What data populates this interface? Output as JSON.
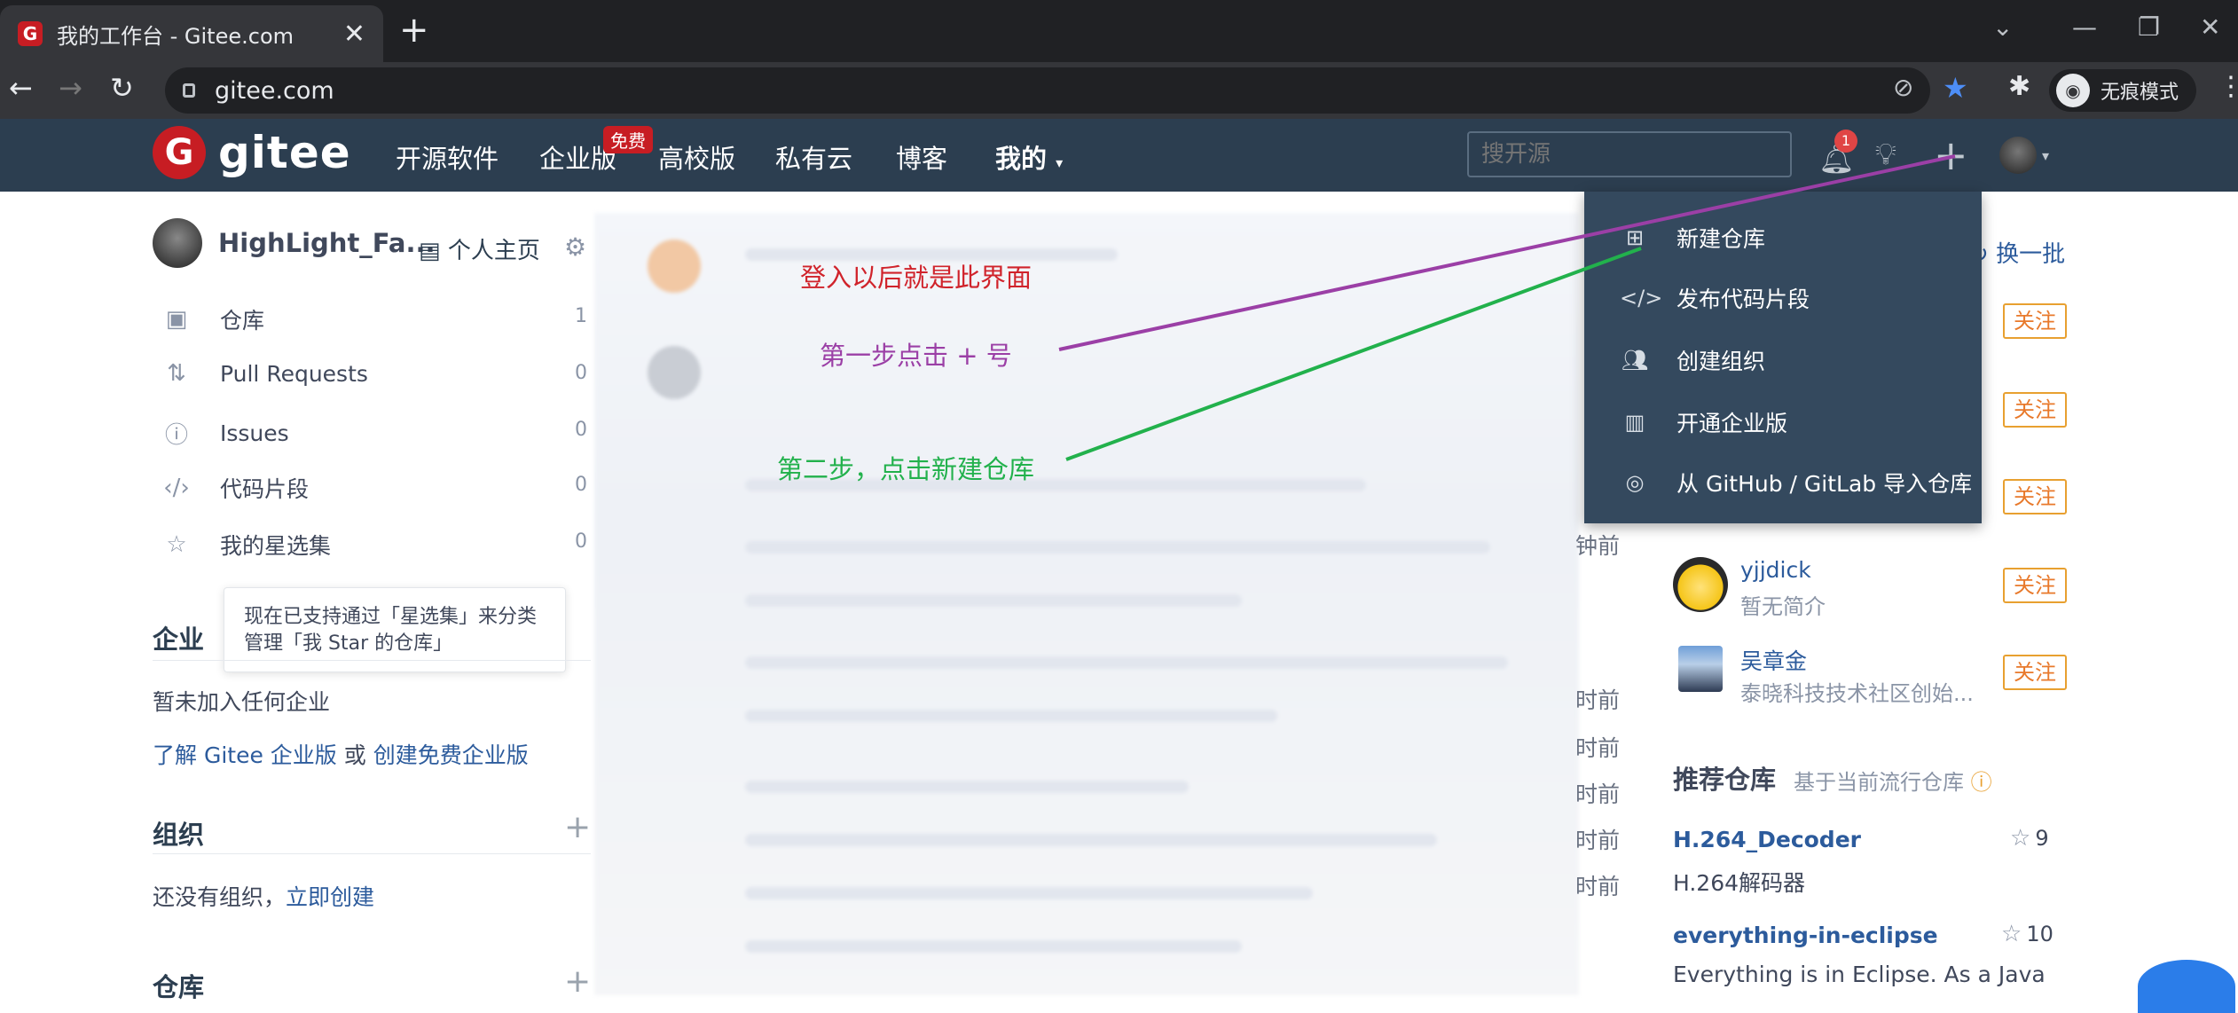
{
  "browser": {
    "tab_title": "我的工作台 - Gitee.com",
    "favicon": "G",
    "url": "gitee.com",
    "incognito_label": "无痕模式"
  },
  "nav": {
    "logo_text": "gitee",
    "items": [
      "开源软件",
      "企业版",
      "高校版",
      "私有云",
      "博客",
      "我的"
    ],
    "free_badge": "免费",
    "search_placeholder": "搜开源",
    "notification_count": "1"
  },
  "sidebar": {
    "username": "HighLight_Fa...",
    "home_link": "个人主页",
    "items": [
      {
        "label": "仓库",
        "count": "1"
      },
      {
        "label": "Pull Requests",
        "count": "0"
      },
      {
        "label": "Issues",
        "count": "0"
      },
      {
        "label": "代码片段",
        "count": "0"
      },
      {
        "label": "我的星选集",
        "count": "0"
      }
    ],
    "tooltip_line1": "现在已支持通过「星选集」来分类",
    "tooltip_line2": "管理「我 Star 的仓库」",
    "enterprise": {
      "title": "企业",
      "none_text": "暂未加入任何企业",
      "learn_link": "了解 Gitee 企业版",
      "or_text": " 或 ",
      "create_link": "创建免费企业版"
    },
    "org": {
      "title": "组织",
      "none_text": "还没有组织，",
      "create_link": "立即创建"
    },
    "repo_title": "仓库"
  },
  "dropdown": {
    "items": [
      "新建仓库",
      "发布代码片段",
      "创建组织",
      "开通企业版",
      "从 GitHub / GitLab 导入仓库"
    ]
  },
  "right": {
    "refresh": "换一批",
    "follow_label": "关注",
    "users": [
      {
        "name": "yjjdick",
        "desc": "暂无简介"
      },
      {
        "name": "吴章金",
        "desc": "泰晓科技技术社区创始..."
      }
    ],
    "rec_title": "推荐仓库",
    "rec_sub": "基于当前流行仓库",
    "repos": [
      {
        "name": "H.264_Decoder",
        "stars": "9",
        "desc": "H.264解码器"
      },
      {
        "name": "everything-in-eclipse",
        "stars": "10",
        "desc": "Everything is in Eclipse. As a Java"
      }
    ]
  },
  "feed": {
    "time_fragments": [
      "钟前",
      "时前",
      "时前",
      "时前",
      "时前",
      "时前"
    ]
  },
  "annotations": {
    "login": "登入以后就是此界面",
    "step1": "第一步点击 + 号",
    "step2": "第二步，点击新建仓库"
  },
  "colors": {
    "nav_bg": "#2c3e50",
    "dropdown_bg": "#34495e",
    "brand_red": "#c71d23",
    "step1_color": "#9b3fa6",
    "step2_color": "#22b14c",
    "login_color": "#d0232b"
  }
}
